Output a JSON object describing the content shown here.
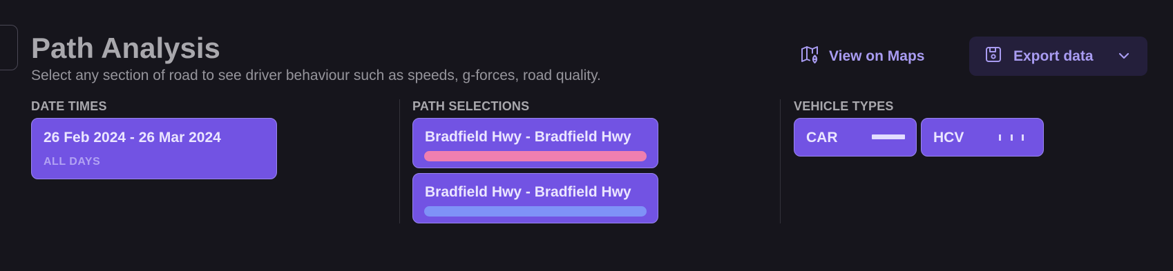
{
  "header": {
    "title": "Path Analysis",
    "subtitle": "Select any section of road to see driver behaviour such as speeds, g-forces, road quality.",
    "view_on_maps_label": "View on Maps",
    "export_label": "Export data"
  },
  "date_times": {
    "label": "DATE TIMES",
    "range": "26 Feb 2024 - 26 Mar 2024",
    "days": "ALL DAYS"
  },
  "path_selections": {
    "label": "PATH SELECTIONS",
    "items": [
      {
        "name": "Bradfield Hwy - Bradfield Hwy",
        "color": "#ef7fb0"
      },
      {
        "name": "Bradfield Hwy - Bradfield Hwy",
        "color": "#7f92f7"
      }
    ]
  },
  "vehicle_types": {
    "label": "VEHICLE TYPES",
    "items": [
      {
        "name": "CAR",
        "line_style": "solid"
      },
      {
        "name": "HCV",
        "line_style": "dashed"
      }
    ]
  },
  "colors": {
    "background": "#16151c",
    "accent": "#7253e3",
    "accent_text": "#a99cf2",
    "export_button_bg": "#241f3b"
  },
  "icons": {
    "maps": "map-pin-icon",
    "export": "save-icon",
    "dropdown": "chevron-down-icon"
  }
}
